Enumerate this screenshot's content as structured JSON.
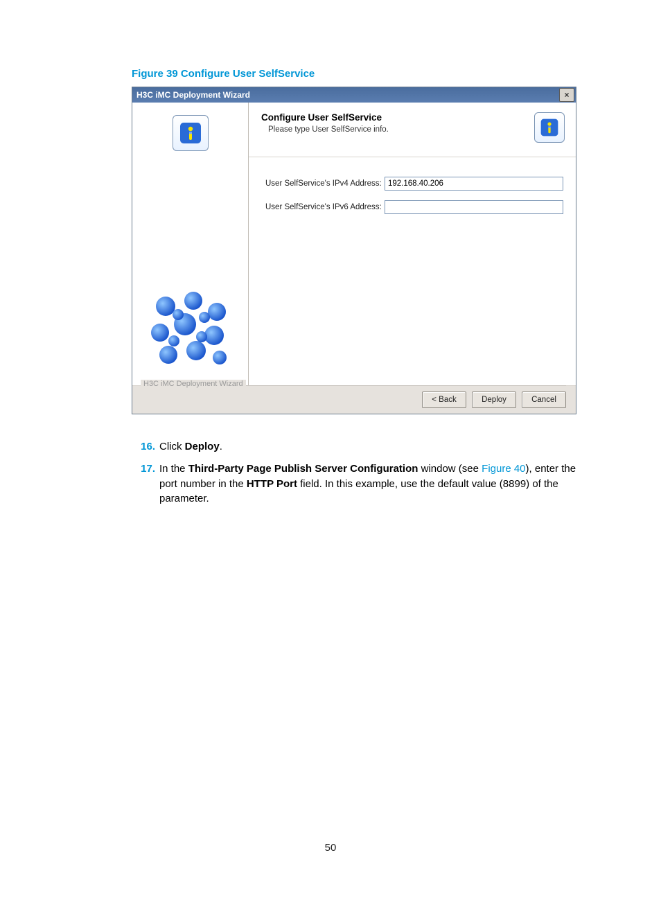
{
  "figure_caption": "Figure 39 Configure User SelfService",
  "dialog": {
    "titlebar": "H3C iMC Deployment Wizard",
    "close_glyph": "×",
    "header_title": "Configure User SelfService",
    "header_sub": "Please type User SelfService info.",
    "fields": {
      "ipv4_label": "User SelfService's IPv4 Address:",
      "ipv4_value": "192.168.40.206",
      "ipv6_label": "User SelfService's IPv6 Address:",
      "ipv6_value": ""
    },
    "footer_label": "H3C iMC Deployment Wizard",
    "buttons": {
      "back": "< Back",
      "deploy": "Deploy",
      "cancel": "Cancel"
    }
  },
  "instructions": {
    "item16_num": "16.",
    "item16_pre": "Click ",
    "item16_bold": "Deploy",
    "item16_post": ".",
    "item17_num": "17.",
    "item17_pre": "In the ",
    "item17_b1": "Third-Party Page Publish Server Configuration",
    "item17_mid1": " window (see ",
    "item17_xref": "Figure 40",
    "item17_mid2": "), enter the port number in the ",
    "item17_b2": "HTTP Port",
    "item17_post": " field. In this example, use the default value (8899) of the parameter."
  },
  "page_number": "50"
}
